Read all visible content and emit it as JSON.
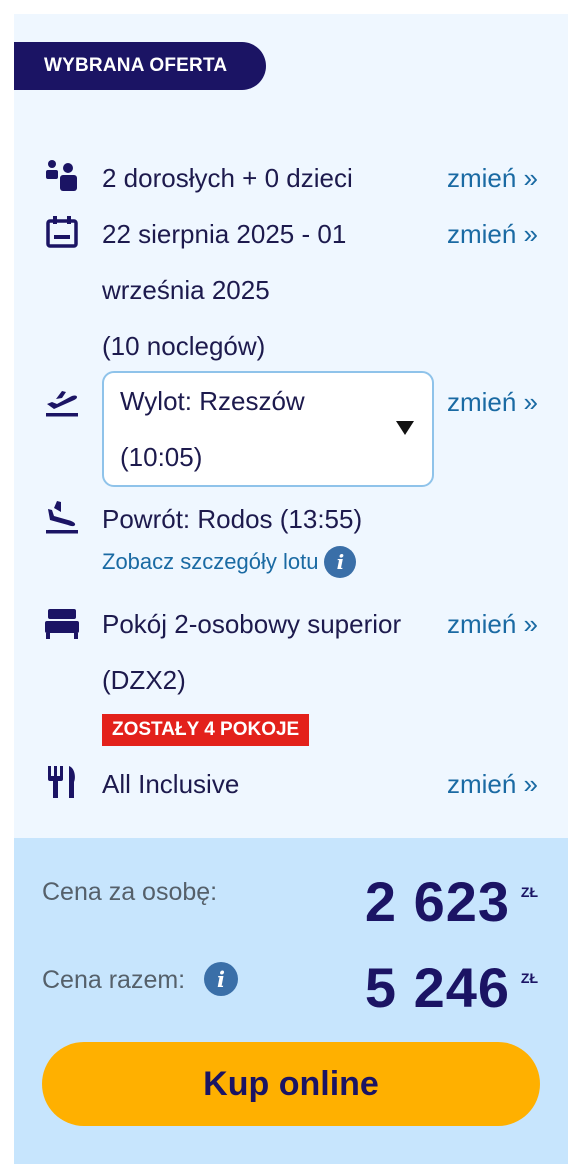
{
  "badge": "WYBRANA OFERTA",
  "change_label": "zmień »",
  "travelers": {
    "text": "2 dorosłych + 0 dzieci"
  },
  "dates": {
    "line1": "22 sierpnia 2025 - 01",
    "line2": "września 2025",
    "line3": "(10 noclegów)"
  },
  "departure": {
    "line1": "Wylot: Rzeszów",
    "line2": "(10:05)"
  },
  "return_flight": {
    "text": "Powrót: Rodos (13:55)"
  },
  "flight_details_link": "Zobacz szczegóły lotu",
  "room": {
    "line1": "Pokój 2-osobowy superior",
    "line2": "(DZX2)",
    "availability": "ZOSTAŁY 4 POKOJE"
  },
  "board": {
    "text": "All Inclusive"
  },
  "price": {
    "per_person_label": "Cena za osobę:",
    "per_person_value": "2 623",
    "total_label": "Cena razem:",
    "total_value": "5 246",
    "currency": "ZŁ"
  },
  "buy_button": "Kup online",
  "colors": {
    "brand_navy": "#1b1464",
    "link_blue": "#1a6aa3",
    "cta_yellow": "#ffb000",
    "alert_red": "#e3211b",
    "card_bg": "#eff7ff",
    "price_bg": "#c7e5fd"
  },
  "icons": [
    "people-icon",
    "calendar-icon",
    "plane-departure-icon",
    "plane-arrival-icon",
    "bed-icon",
    "cutlery-icon",
    "info-icon",
    "dropdown-caret-icon"
  ]
}
